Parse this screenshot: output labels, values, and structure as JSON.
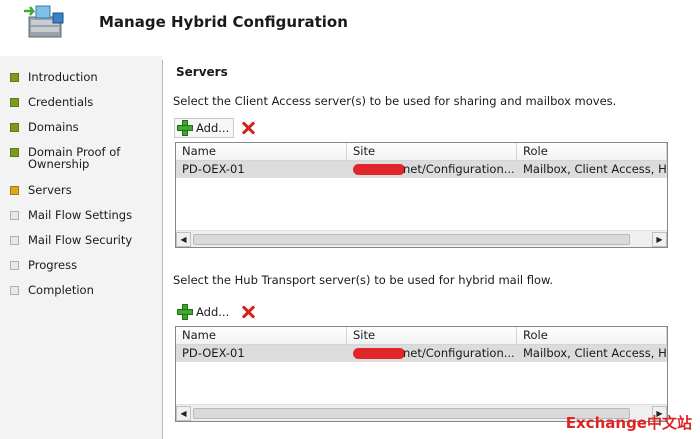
{
  "title": "Manage Hybrid Configuration",
  "sidebar": {
    "items": [
      {
        "label": "Introduction",
        "state": "done"
      },
      {
        "label": "Credentials",
        "state": "done"
      },
      {
        "label": "Domains",
        "state": "done"
      },
      {
        "label": "Domain Proof of\nOwnership",
        "state": "done"
      },
      {
        "label": "Servers",
        "state": "current"
      },
      {
        "label": "Mail Flow Settings",
        "state": "pending"
      },
      {
        "label": "Mail Flow Security",
        "state": "pending"
      },
      {
        "label": "Progress",
        "state": "pending"
      },
      {
        "label": "Completion",
        "state": "pending"
      }
    ]
  },
  "main": {
    "section_title": "Servers",
    "cas": {
      "description": "Select the Client Access server(s) to be used for sharing and mailbox moves.",
      "add_label": "Add...",
      "columns": [
        "Name",
        "Site",
        "Role"
      ],
      "rows": [
        {
          "name": "PD-OEX-01",
          "site": "net/Configuration...",
          "role": "Mailbox, Client Access, Hu"
        }
      ]
    },
    "hub": {
      "description": "Select the Hub Transport server(s) to be used for hybrid mail flow.",
      "add_label": "Add...",
      "columns": [
        "Name",
        "Site",
        "Role"
      ],
      "rows": [
        {
          "name": "PD-OEX-01",
          "site": "net/Configuration...",
          "role": "Mailbox, Client Access, Hu"
        }
      ]
    }
  },
  "icons": {
    "wizard": "wizard-server-icon",
    "add": "plus-icon",
    "delete": "delete-x-icon",
    "scroll_left": "scroll-left-arrow-icon",
    "scroll_right": "scroll-right-arrow-icon"
  },
  "colors": {
    "done": "#7b9a1f",
    "current": "#d7a820",
    "pending": "#e8e8e8",
    "redaction": "#e0262b",
    "watermark": "#e02424"
  },
  "watermark": "Exchange中文站"
}
